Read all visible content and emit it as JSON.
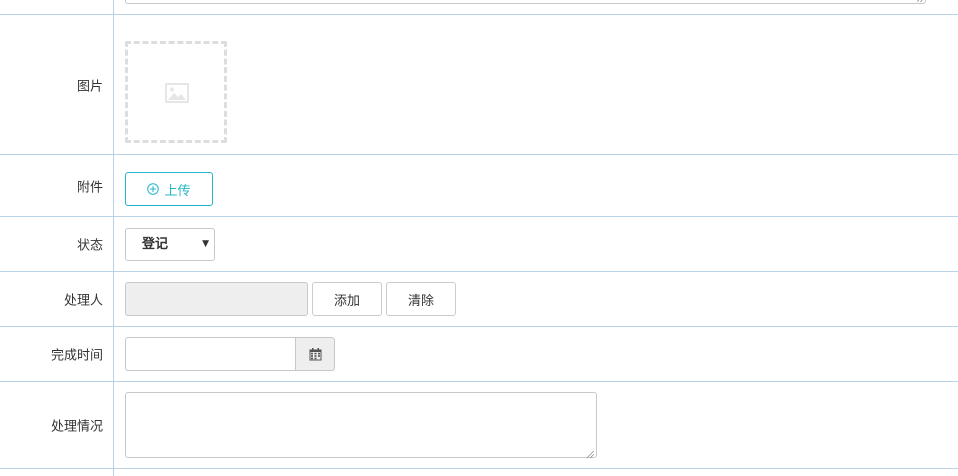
{
  "form": {
    "image": {
      "label": "图片",
      "placeholder_icon": "image-icon"
    },
    "attachment": {
      "label": "附件",
      "upload_label": "上传",
      "upload_icon": "plus-circle-icon"
    },
    "status": {
      "label": "状态",
      "selected": "登记",
      "arrow": "▼"
    },
    "handler": {
      "label": "处理人",
      "value": "",
      "add_label": "添加",
      "clear_label": "清除"
    },
    "finish_time": {
      "label": "完成时间",
      "value": "",
      "calendar_icon": "calendar-icon"
    },
    "description": {
      "label": "处理情况",
      "value": ""
    }
  },
  "colors": {
    "border": "#b9d2e6",
    "accent": "#23b7c9",
    "input_border": "#c8c8c8",
    "disabled_bg": "#eeeeee",
    "placeholder_border": "#dddddd"
  }
}
